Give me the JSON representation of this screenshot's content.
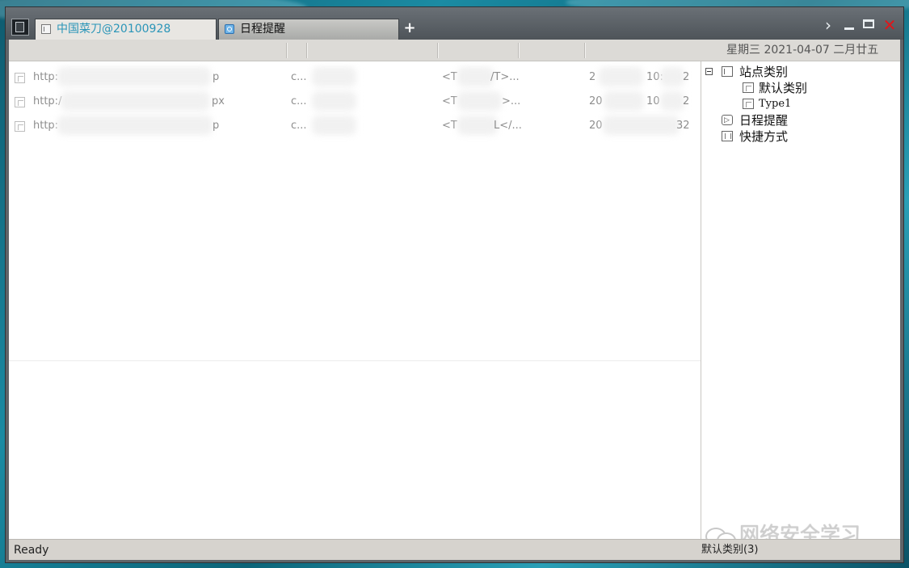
{
  "window": {
    "tabs": [
      {
        "label": "中国菜刀@20100928",
        "active": true
      },
      {
        "label": "日程提醒",
        "active": false
      }
    ],
    "add_tab_label": "+"
  },
  "header": {
    "date_text": "星期三  2021-04-07 二月廿五"
  },
  "list": {
    "rows": [
      {
        "url": "http:",
        "url_tail": "p",
        "ip": "c...",
        "note": "<T",
        "note_tail": "/T>...",
        "time_head": "2",
        "time_mid": "10:",
        "time_tail": "2"
      },
      {
        "url": "http:/",
        "url_tail": "px",
        "ip": "c...",
        "note": "<T",
        "note_tail": ">...",
        "time_head": "20",
        "time_mid": "10",
        "time_tail": "2"
      },
      {
        "url": "http:",
        "url_tail": "p",
        "ip": "c...",
        "note": "<T",
        "note_tail": "L</...",
        "time_head": "20",
        "time_mid": "",
        "time_tail": "32"
      }
    ]
  },
  "tree": {
    "root": "站点类别",
    "children": [
      "默认类别",
      "Type1"
    ],
    "schedule": "日程提醒",
    "shortcuts": "快捷方式"
  },
  "watermark": "网络安全学习",
  "status": {
    "left": "Ready",
    "right": "默认类别(3)"
  },
  "colors": {
    "active_tab_text": "#2a95b8",
    "close_button": "#e0161a",
    "background": "#1b8ba3"
  }
}
